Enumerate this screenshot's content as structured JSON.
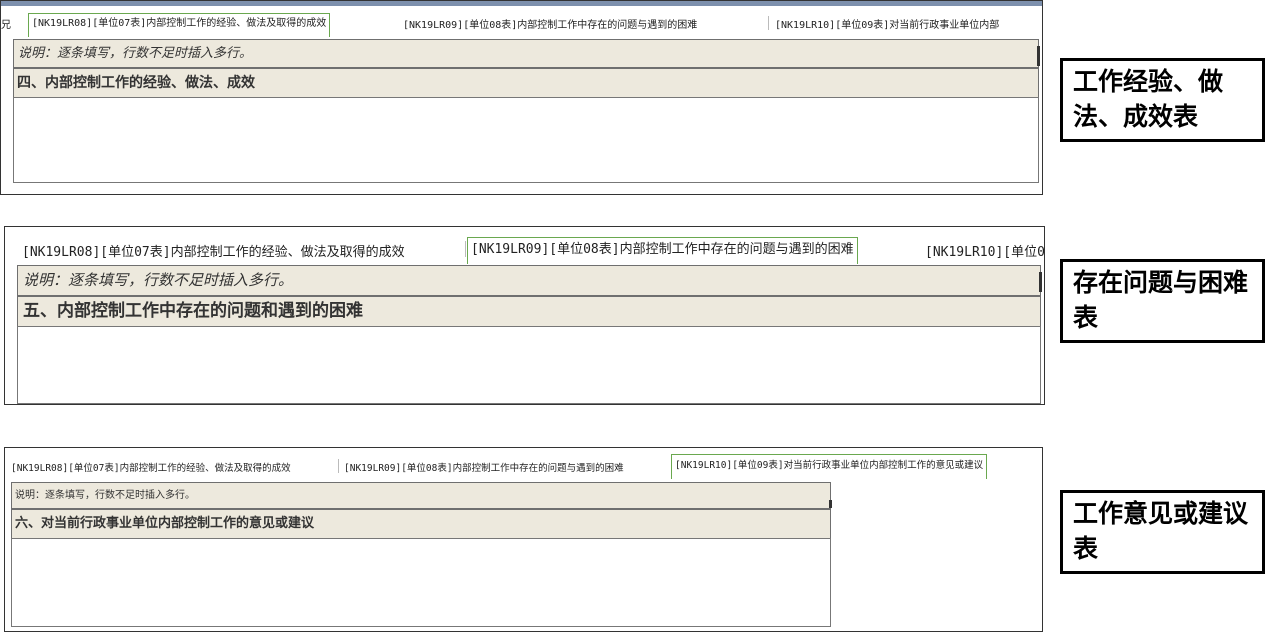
{
  "panel1": {
    "tabs": [
      {
        "label": "兄",
        "active": false
      },
      {
        "label": "[NK19LR08][单位07表]内部控制工作的经验、做法及取得的成效",
        "active": true
      },
      {
        "label": "[NK19LR09][单位08表]内部控制工作中存在的问题与遇到的困难",
        "active": false
      },
      {
        "label": "[NK19LR10][单位09表]对当前行政事业单位内部",
        "active": false
      }
    ],
    "note": "说明：逐条填写，行数不足时插入多行。",
    "heading": "四、内部控制工作的经验、做法、成效"
  },
  "panel2": {
    "tabs": [
      {
        "label": "[NK19LR08][单位07表]内部控制工作的经验、做法及取得的成效",
        "active": false
      },
      {
        "label": "[NK19LR09][单位08表]内部控制工作中存在的问题与遇到的困难",
        "active": true
      },
      {
        "label": "[NK19LR10][单位0",
        "active": false
      }
    ],
    "note": "说明：逐条填写，行数不足时插入多行。",
    "heading": "五、内部控制工作中存在的问题和遇到的困难"
  },
  "panel3": {
    "tabs": [
      {
        "label": "[NK19LR08][单位07表]内部控制工作的经验、做法及取得的成效",
        "active": false
      },
      {
        "label": "[NK19LR09][单位08表]内部控制工作中存在的问题与遇到的困难",
        "active": false
      },
      {
        "label": "[NK19LR10][单位09表]对当前行政事业单位内部控制工作的意见或建议",
        "active": true
      }
    ],
    "note": "说明：逐条填写，行数不足时插入多行。",
    "heading": "六、对当前行政事业单位内部控制工作的意见或建议"
  },
  "labels": {
    "label1": "工作经验、做法、成效表",
    "label2": "存在问题与困难表",
    "label3": "工作意见或建议表"
  }
}
